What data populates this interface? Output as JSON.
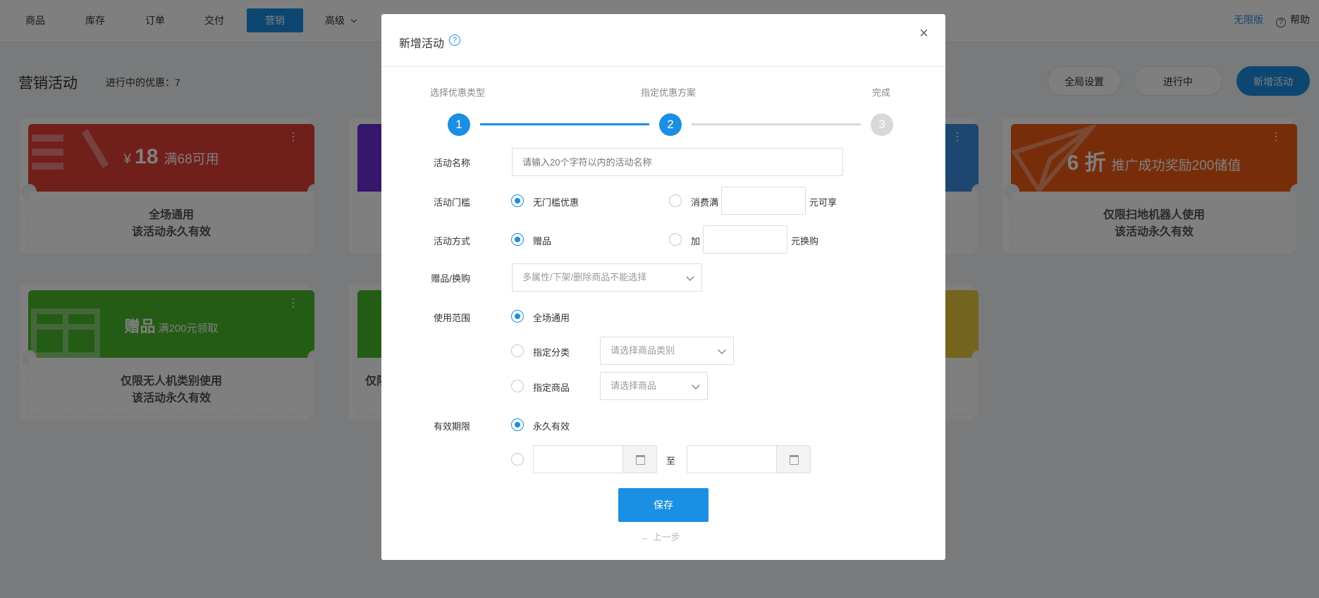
{
  "nav": {
    "items": [
      {
        "label": "商品"
      },
      {
        "label": "库存"
      },
      {
        "label": "订单"
      },
      {
        "label": "交付"
      },
      {
        "label": "营销"
      },
      {
        "label": "高级"
      }
    ],
    "edition": "无限版",
    "help": "帮助",
    "help_icon": "?"
  },
  "page": {
    "title": "营销活动",
    "running": "进行中的优惠：7",
    "btn_global": "全局设置",
    "btn_status": "进行中",
    "btn_add": "新增活动"
  },
  "cards": [
    {
      "prefix": "¥",
      "big": "18",
      "rest": "满68可用",
      "line1": "全场通用",
      "line2": "该活动永久有效",
      "color": "#e23f37"
    },
    {
      "prefix": "",
      "big": "6 折",
      "rest": "推广成功奖励200储值",
      "line1": "仅限扫地机器人使用",
      "line2": "该活动永久有效",
      "color": "#f05a14"
    },
    {
      "prefix": "",
      "big": "赠品",
      "rest": "满200元领取",
      "line1": "仅限无人机类别使用",
      "line2": "该活动永久有效",
      "color": "#49b82a"
    },
    {
      "partial": "仅限"
    }
  ],
  "menu_icon": "⋮",
  "modal": {
    "title": "新增活动",
    "help_icon": "?",
    "close_icon": "×",
    "steps": [
      {
        "num": "1",
        "label": "选择优惠类型"
      },
      {
        "num": "2",
        "label": "指定优惠方案"
      },
      {
        "num": "3",
        "label": "完成"
      }
    ],
    "fields": {
      "name_label": "活动名称",
      "name_placeholder": "请输入20个字符以内的活动名称",
      "threshold_label": "活动门槛",
      "threshold_opt1": "无门槛优惠",
      "threshold_opt2": "消费满",
      "threshold_suffix": "元可享",
      "method_label": "活动方式",
      "method_opt1": "赠品",
      "method_opt2": "加",
      "method_suffix": "元换购",
      "gift_label": "赠品/换购",
      "gift_placeholder": "多属性/下架/删除商品不能选择",
      "scope_label": "使用范围",
      "scope_opt1": "全场通用",
      "scope_opt2": "指定分类",
      "scope_cat_placeholder": "请选择商品类别",
      "scope_opt3": "指定商品",
      "scope_goods_placeholder": "请选择商品",
      "validity_label": "有效期限",
      "validity_opt1": "永久有效",
      "date_sep": "至"
    },
    "save": "保存",
    "prev": "← 上一步"
  },
  "colors": {
    "accent": "#1a8fe3",
    "green": "#49b82a",
    "red": "#e23f37",
    "orange": "#f05a14",
    "purple": "#6a2fd6"
  }
}
